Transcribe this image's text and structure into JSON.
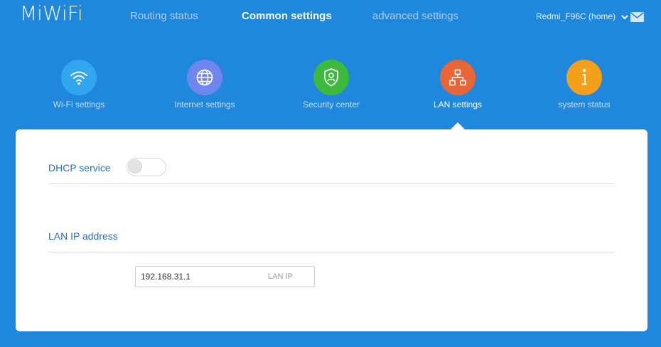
{
  "header": {
    "logo": "MiWiFi",
    "nav": [
      {
        "label": "Routing status",
        "active": false
      },
      {
        "label": "Common settings",
        "active": true
      },
      {
        "label": "advanced settings",
        "active": false
      }
    ],
    "user": "Redmi_F96C (home)"
  },
  "categories": [
    {
      "label": "Wi-Fi settings",
      "color": "#32a6ee",
      "icon": "wifi-icon",
      "active": false
    },
    {
      "label": "Internet settings",
      "color": "#6f86ef",
      "icon": "globe-icon",
      "active": false
    },
    {
      "label": "Security center",
      "color": "#3dba3b",
      "icon": "shield-user-icon",
      "active": false
    },
    {
      "label": "LAN settings",
      "color": "#e76537",
      "icon": "network-tree-icon",
      "active": true
    },
    {
      "label": "system status",
      "color": "#f5a01b",
      "icon": "info-icon",
      "active": false
    }
  ],
  "panel": {
    "dhcp_label": "DHCP service",
    "dhcp_enabled": false,
    "lan_ip_heading": "LAN IP address",
    "ip_value": "192.168.31.1",
    "ip_suffix": "LAN IP"
  },
  "colors": {
    "background": "#1f88dd",
    "panel": "#ffffff",
    "label_blue": "#2a6fbf"
  }
}
